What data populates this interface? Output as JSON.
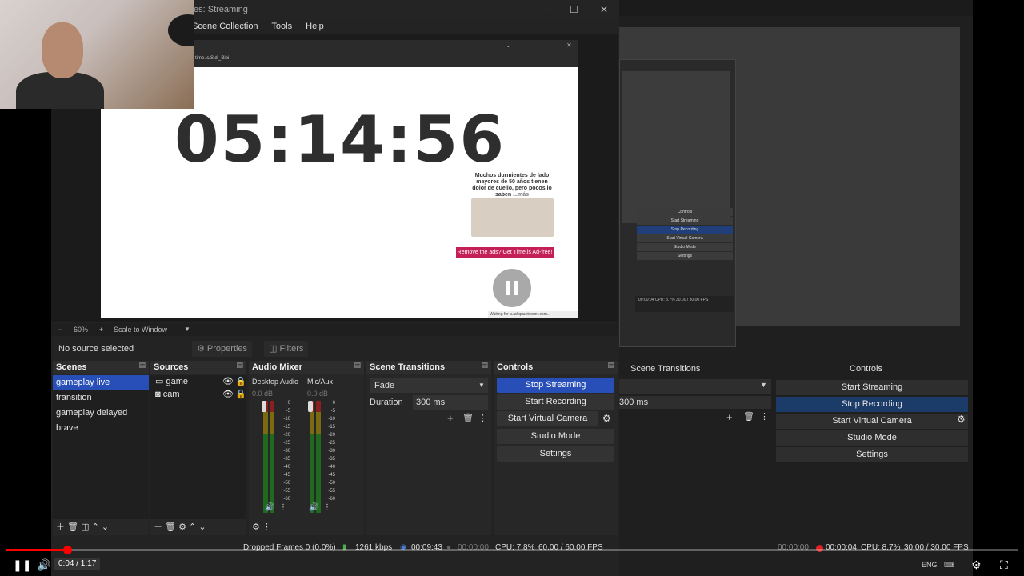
{
  "window": {
    "title": "es: Streaming",
    "min": "─",
    "max": "☐",
    "close": "✕"
  },
  "menu": [
    "Scene Collection",
    "Tools",
    "Help"
  ],
  "preview": {
    "site": "time.is/Sidi_Bibi",
    "clock": "05:14:56",
    "ad_text": "Muchos durmientes de lado mayores de 50 años tienen dolor de cuello, pero pocos lo saben",
    "ad_more": "...más",
    "ad_button": "Remove the ads? Get Time.is Ad-free!",
    "waiting": "Waiting for a.ad.quantcount.com..."
  },
  "zoombar": {
    "minus": "−",
    "zoom": "60%",
    "plus": "+",
    "mode": "Scale to Window"
  },
  "noselect": {
    "label": "No source selected",
    "properties": "Properties",
    "filters": "Filters"
  },
  "scenes": {
    "title": "Scenes",
    "items": [
      "gameplay live",
      "transition",
      "gameplay delayed",
      "brave"
    ]
  },
  "sources": {
    "title": "Sources",
    "items": [
      {
        "name": "game",
        "icon": "window-icon"
      },
      {
        "name": "cam",
        "icon": "camera-icon"
      }
    ]
  },
  "mixer": {
    "title": "Audio Mixer",
    "channels": [
      {
        "name": "Desktop Audio",
        "db": "0.0 dB"
      },
      {
        "name": "Mic/Aux",
        "db": "0.0 dB"
      }
    ],
    "scale": [
      "0",
      "-5",
      "-10",
      "-15",
      "-20",
      "-25",
      "-30",
      "-35",
      "-40",
      "-45",
      "-50",
      "-55",
      "-60"
    ]
  },
  "transitions": {
    "title": "Scene Transitions",
    "selected": "Fade",
    "duration_label": "Duration",
    "duration": "300 ms"
  },
  "controls": {
    "title": "Controls",
    "buttons": [
      "Stop Streaming",
      "Start Recording",
      "Start Virtual Camera",
      "Studio Mode",
      "Settings"
    ]
  },
  "status": {
    "dropped": "Dropped Frames 0 (0.0%)",
    "kbps": "1261 kbps",
    "stream_time": "00:09:43",
    "rec_time": "00:00:00",
    "cpu": "CPU: 7.8%",
    "fps": "60.00 / 60.00 FPS"
  },
  "right_panel": {
    "transitions_title": "Scene Transitions",
    "controls_title": "Controls",
    "duration": "300 ms",
    "buttons": [
      "Start Streaming",
      "Stop Recording",
      "Start Virtual Camera",
      "Studio Mode",
      "Settings"
    ],
    "mini_buttons": [
      "Controls",
      "Start Streaming",
      "Stop Recording",
      "Start Virtual Camera",
      "Studio Mode",
      "Settings"
    ],
    "mini_status": "00:00:04  CPU: 8.7%  30.00 / 30.00 FPS",
    "status": {
      "stream": "00:00:00",
      "rec": "00:00:04",
      "cpu": "CPU: 8.7%",
      "fps": "30.00 / 30.00 FPS"
    },
    "lang": "ENG"
  },
  "player": {
    "time": "0:04 / 1:17",
    "progress": 0.06
  }
}
